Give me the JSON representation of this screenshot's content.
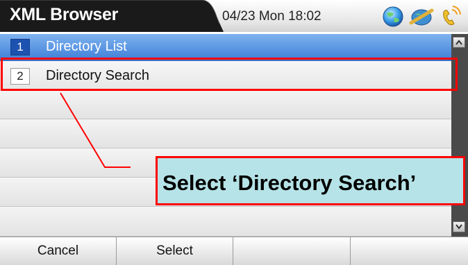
{
  "header": {
    "title": "XML Browser",
    "datetime": "04/23 Mon 18:02",
    "icons": [
      "globe-icon",
      "network-icon",
      "handset-ringing-icon"
    ]
  },
  "list": {
    "items": [
      {
        "number": "1",
        "label": "Directory List",
        "selected": true
      },
      {
        "number": "2",
        "label": "Directory Search",
        "selected": false
      }
    ],
    "empty_rows": 5
  },
  "softkeys": [
    "Cancel",
    "Select",
    "",
    ""
  ],
  "annotation": {
    "text": "Select ‘Directory Search’"
  },
  "colors": {
    "title_tab": "#1a1a1a",
    "selected_row": "#3e7fd8",
    "highlight": "#ff0000",
    "callout_fill": "#b6e3e7"
  }
}
